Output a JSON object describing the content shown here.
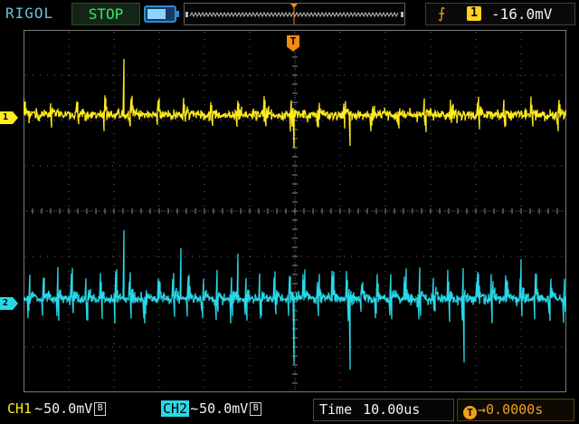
{
  "topbar": {
    "brand": "RIGOL",
    "run_state": "STOP",
    "battery_icon": "battery-icon",
    "battery_level": 0.75,
    "trigger": {
      "edge_icon": "rising-edge-icon",
      "source": "1",
      "level": "-16.0mV"
    }
  },
  "screen": {
    "ch1_marker": "1",
    "ch2_marker": "2",
    "trigger_marker": "T",
    "ch1_color": "#ffeb1e",
    "ch2_color": "#29d8e8",
    "trigger_color": "#f08a10"
  },
  "bottombar": {
    "ch1": {
      "name": "CH1",
      "coupling": "~",
      "scale": "50.0mV",
      "bw": "B"
    },
    "ch2": {
      "name": "CH2",
      "coupling": "~",
      "scale": "50.0mV",
      "bw": "B"
    },
    "timebase": {
      "label": "Time",
      "value": "10.00us"
    },
    "trigger_offset": {
      "icon": "T",
      "value": "0.0000s"
    }
  }
}
